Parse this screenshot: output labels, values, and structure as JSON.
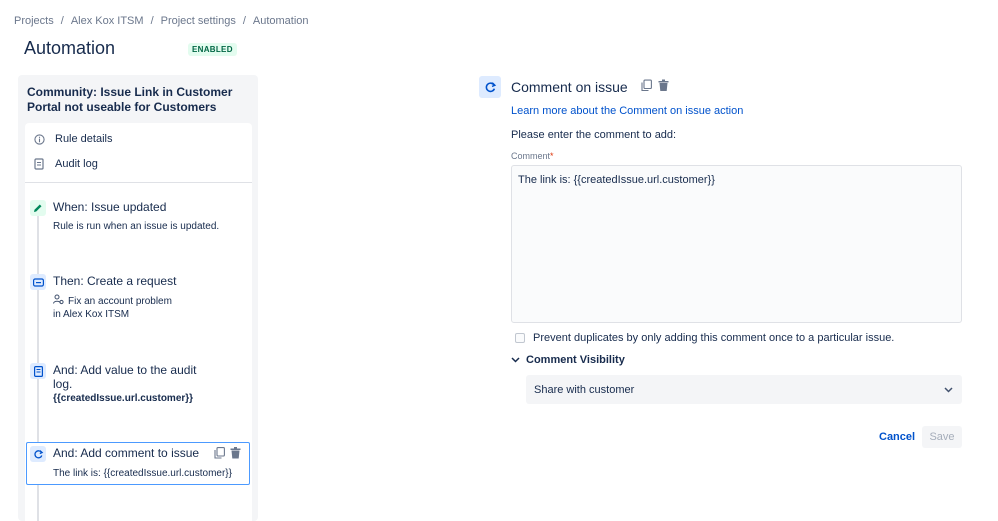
{
  "breadcrumb": {
    "items": [
      "Projects",
      "Alex Kox ITSM",
      "Project settings",
      "Automation"
    ],
    "separator": "/"
  },
  "header": {
    "title": "Automation",
    "status": "ENABLED"
  },
  "rule": {
    "name": "Community: Issue Link in Customer Portal not useable for Customers",
    "menu": [
      {
        "label": "Rule details",
        "icon": "info-icon"
      },
      {
        "label": "Audit log",
        "icon": "document-icon"
      }
    ],
    "steps": [
      {
        "title": "When: Issue updated",
        "desc": "Rule is run when an issue is updated.",
        "icon": "pencil-icon",
        "color": "#00875a"
      },
      {
        "title": "Then: Create a request",
        "desc_line1": "Fix an account problem",
        "desc_line2": "in Alex Kox ITSM",
        "icon": "request-icon",
        "color": "#0052cc"
      },
      {
        "title_line1": "And: Add value to the audit",
        "title_line2": "log.",
        "desc": "{{createdIssue.url.customer}}",
        "icon": "audit-icon",
        "color": "#0052cc"
      },
      {
        "title": "And: Add comment to issue",
        "desc": "The link is: {{createdIssue.url.customer}}",
        "icon": "comment-action-icon",
        "color": "#0052cc"
      }
    ]
  },
  "action": {
    "title": "Comment on issue",
    "learn_link": "Learn more about the Comment on issue action",
    "instruction": "Please enter the comment to add:",
    "comment_label": "Comment",
    "required_mark": "*",
    "comment_value": "The link is: {{createdIssue.url.customer}}",
    "prevent_duplicates_label": "Prevent duplicates by only adding this comment once to a particular issue.",
    "prevent_duplicates_checked": false,
    "visibility_label": "Comment Visibility",
    "visibility_value": "Share with customer",
    "cancel_label": "Cancel",
    "save_label": "Save"
  },
  "colors": {
    "accent": "#0052cc",
    "success": "#006644",
    "border_selected": "#4c9aff"
  }
}
